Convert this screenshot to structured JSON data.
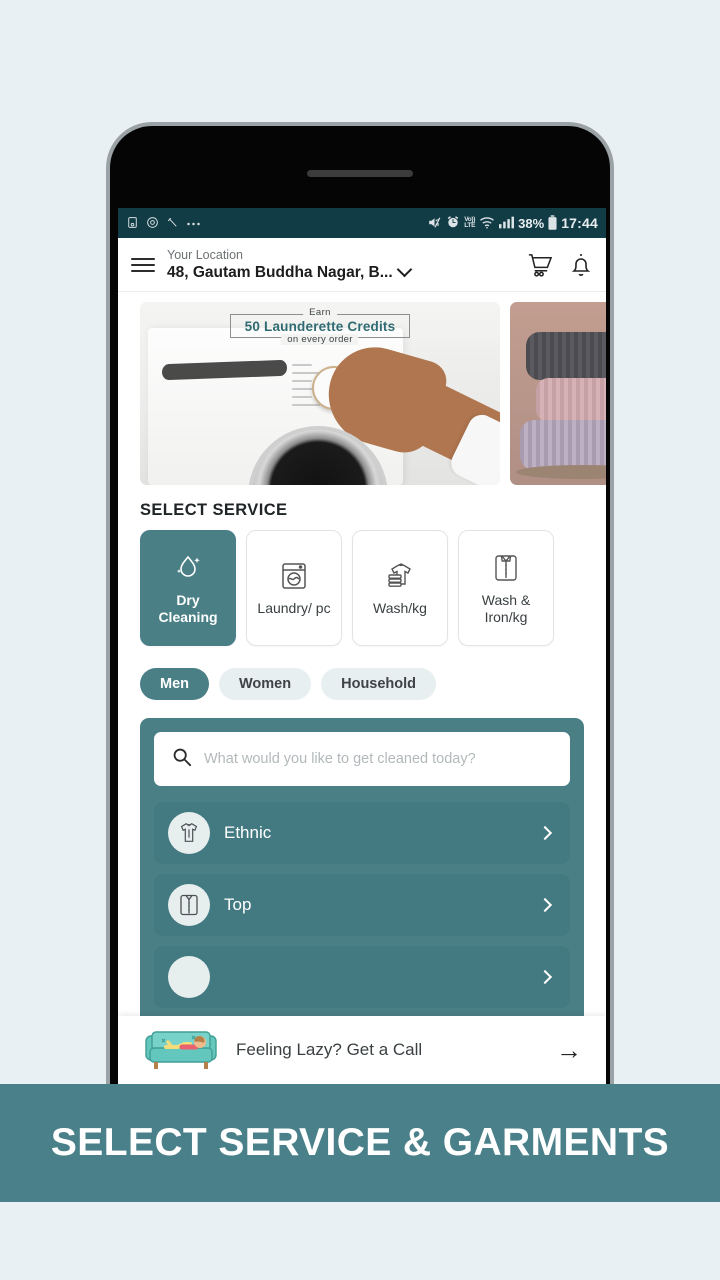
{
  "caption": {
    "text": "SELECT SERVICE & GARMENTS"
  },
  "statusbar": {
    "left_icons": [
      "sim-card-icon",
      "alarm-target-icon",
      "magic-wand-icon",
      "more-dots-icon"
    ],
    "mute_icon": "mute-icon",
    "alarm_icon": "alarm-icon",
    "volte_top": "Vo))",
    "volte_bottom": "LTE",
    "wifi_icon": "wifi-icon",
    "signal_icon": "signal-bars-icon",
    "battery_percent": "38%",
    "battery_icon": "battery-icon",
    "time": "17:44"
  },
  "header": {
    "menu_icon": "hamburger-menu-icon",
    "location_label": "Your Location",
    "location_value": "48, Gautam Buddha Nagar, B...",
    "chevron_icon": "chevron-down-icon",
    "cart_icon": "cart-icon",
    "bell_icon": "bell-icon"
  },
  "banners": [
    {
      "id": "credits-banner",
      "earn_text": "Earn",
      "main_text": "50 Launderette Credits",
      "sub_text": "on every order",
      "image": "washing-machine-photo"
    },
    {
      "id": "sweaters-banner",
      "image": "folded-sweaters-photo"
    }
  ],
  "select_service": {
    "title": "SELECT SERVICE",
    "cards": [
      {
        "label": "Dry Cleaning",
        "icon": "water-drop-icon",
        "selected": true
      },
      {
        "label": "Laundry/ pc",
        "icon": "washing-machine-icon",
        "selected": false
      },
      {
        "label": "Wash/kg",
        "icon": "tshirt-scale-icon",
        "selected": false
      },
      {
        "label": "Wash & Iron/kg",
        "icon": "folded-shirt-icon",
        "selected": false
      }
    ]
  },
  "category_chips": [
    {
      "label": "Men",
      "selected": true
    },
    {
      "label": "Women",
      "selected": false
    },
    {
      "label": "Household",
      "selected": false
    }
  ],
  "search": {
    "placeholder": "What would you like to get cleaned today?",
    "icon": "search-icon",
    "value": ""
  },
  "garment_list": [
    {
      "label": "Ethnic",
      "icon": "kurta-icon",
      "chevron": "chevron-right-icon"
    },
    {
      "label": "Top",
      "icon": "folded-shirt-icon",
      "chevron": "chevron-right-icon"
    },
    {
      "label": "",
      "icon": "garment-icon",
      "chevron": "chevron-right-icon"
    }
  ],
  "bottom_bar": {
    "illustration": "person-on-couch-icon",
    "text": "Feeling Lazy? Get a Call",
    "arrow_icon": "arrow-right-icon"
  },
  "colors": {
    "brand_teal": "#4a7f86",
    "caption_teal": "#4a8089",
    "statusbar_teal": "#123c45",
    "page_background": "#e9f0f3",
    "chip_inactive": "#e8eff0"
  }
}
